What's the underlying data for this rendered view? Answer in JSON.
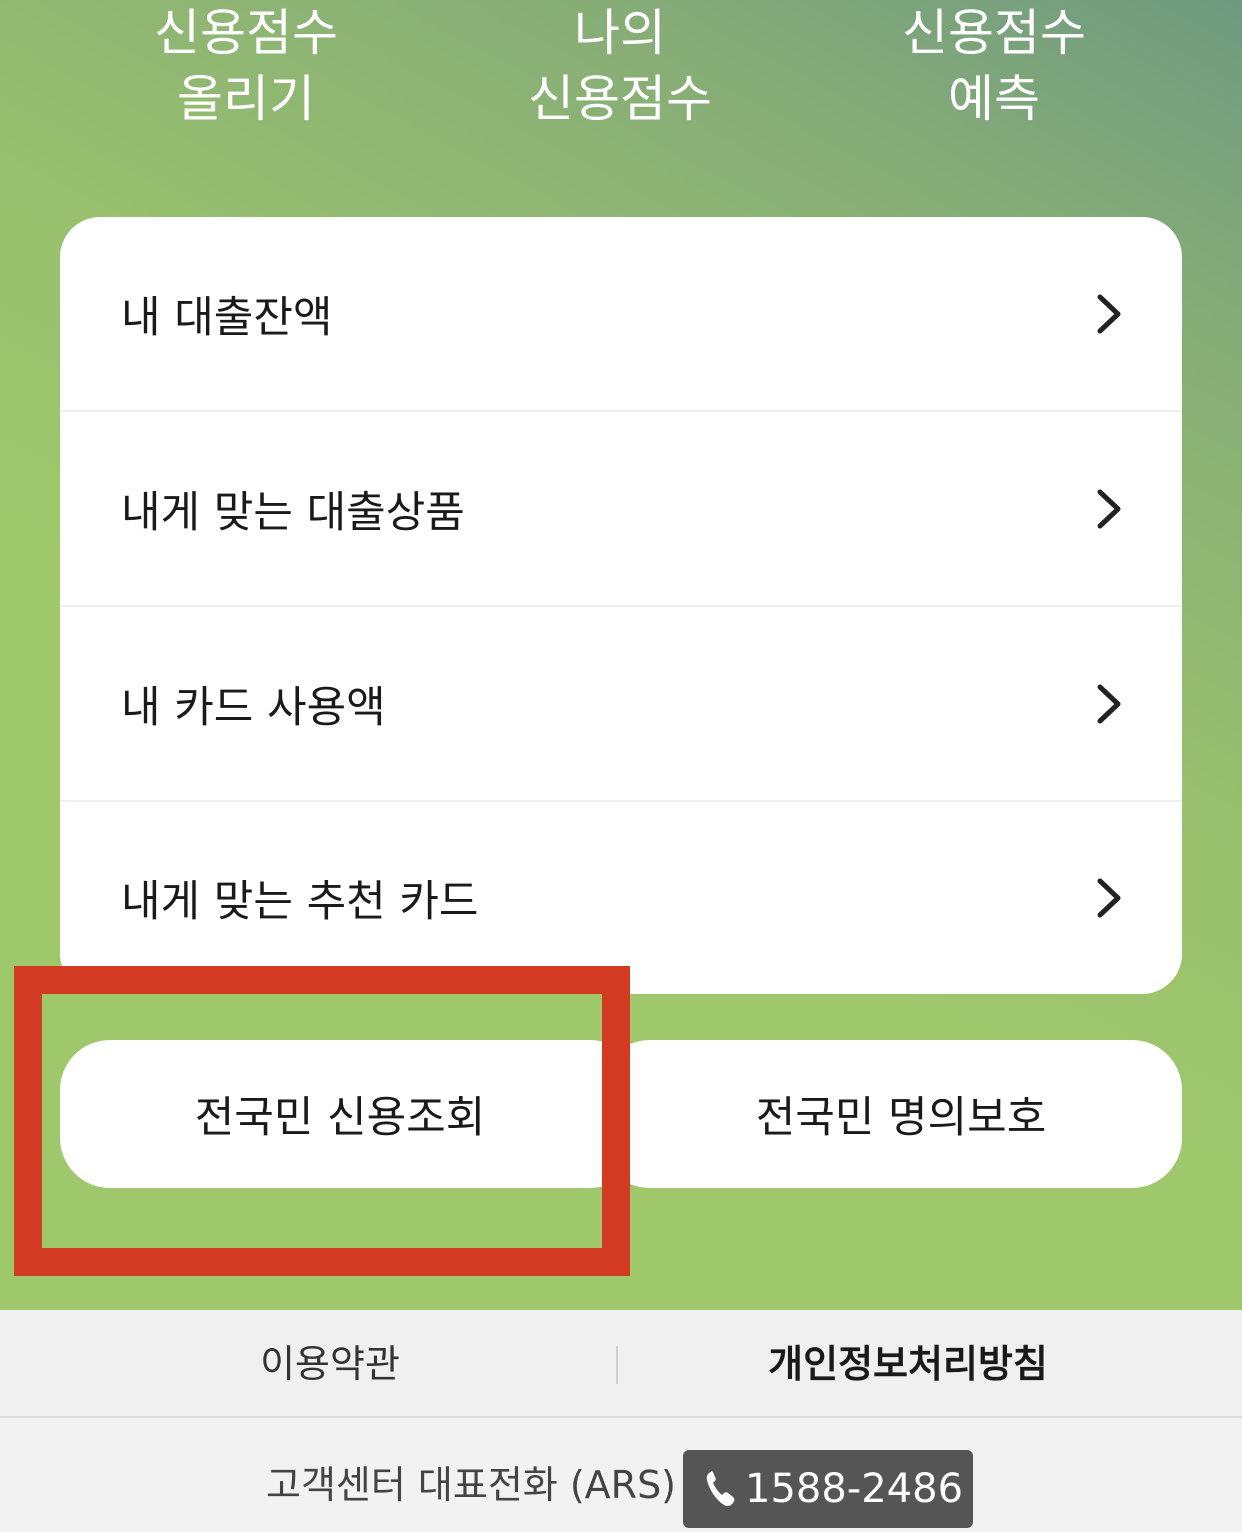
{
  "top_tabs": [
    {
      "line1": "신용점수",
      "line2": "올리기"
    },
    {
      "line1": "나의",
      "line2": "신용점수"
    },
    {
      "line1": "신용점수",
      "line2": "예측"
    }
  ],
  "menu": {
    "items": [
      {
        "label": "내 대출잔액"
      },
      {
        "label": "내게 맞는 대출상품"
      },
      {
        "label": "내 카드 사용액"
      },
      {
        "label": "내게 맞는 추천 카드"
      }
    ]
  },
  "buttons": {
    "credit_check": "전국민 신용조회",
    "identity_protect": "전국민 명의보호"
  },
  "footer": {
    "terms": "이용약관",
    "privacy": "개인정보처리방침",
    "call_label": "고객센터 대표전화 (ARS)",
    "call_number": "1588-2486"
  },
  "colors": {
    "highlight": "#d23a22",
    "background_green": "#9fc76c"
  }
}
